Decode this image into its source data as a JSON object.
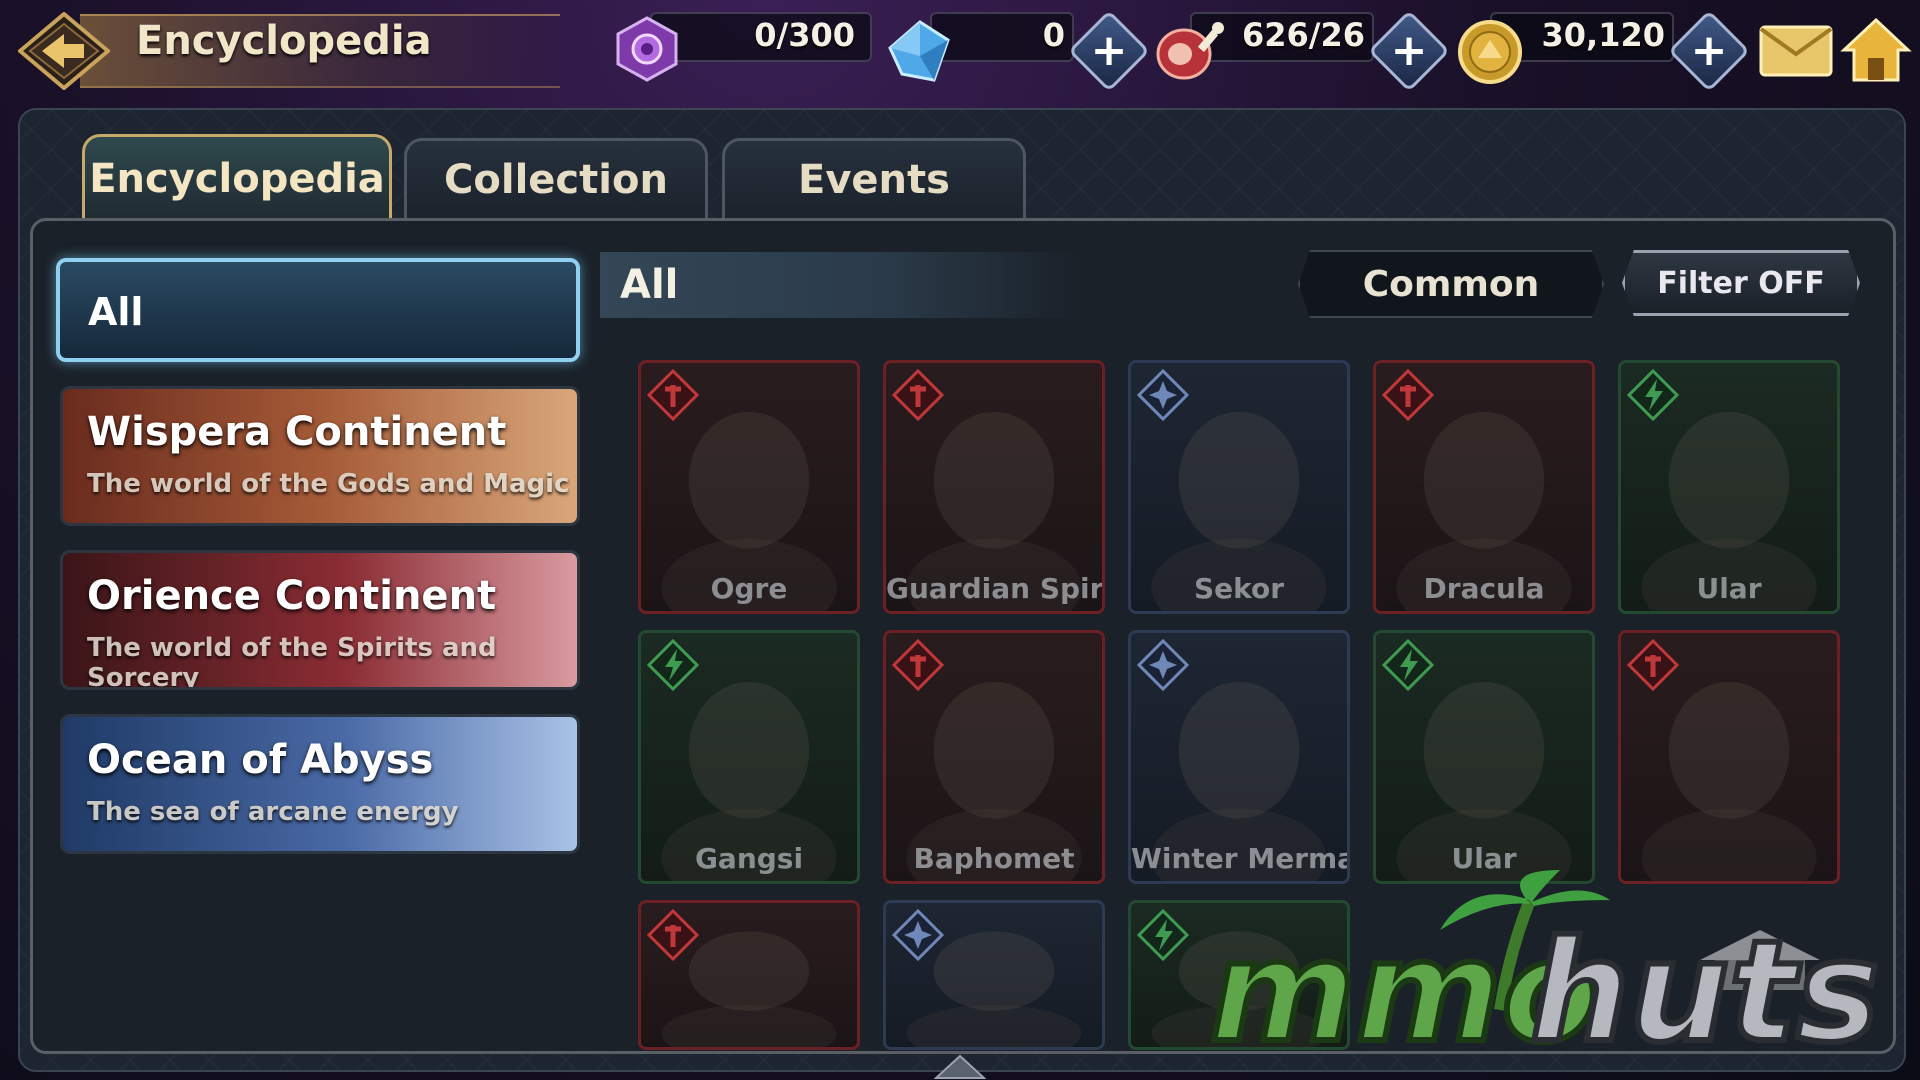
{
  "header": {
    "title": "Encyclopedia",
    "resources": [
      {
        "name": "soul-gem",
        "value": "0/300"
      },
      {
        "name": "crystal",
        "value": "0"
      },
      {
        "name": "meat-stamina",
        "value": "626/26"
      },
      {
        "name": "gold",
        "value": "30,120"
      }
    ]
  },
  "tabs": [
    {
      "label": "Encyclopedia",
      "active": true
    },
    {
      "label": "Collection",
      "active": false
    },
    {
      "label": "Events",
      "active": false
    }
  ],
  "categories": {
    "all_label": "All",
    "items": [
      {
        "title": "Wispera Continent",
        "subtitle": "The world of the Gods and Magic"
      },
      {
        "title": "Orience Continent",
        "subtitle": "The world of the Spirits and Sorcery"
      },
      {
        "title": "Ocean of Abyss",
        "subtitle": "The sea of arcane energy"
      }
    ]
  },
  "list_header": {
    "title": "All",
    "sort_label": "Common",
    "filter_label": "Filter OFF"
  },
  "cards": [
    {
      "name": "Ogre",
      "element": "fire"
    },
    {
      "name": "Guardian Spirit",
      "element": "fire"
    },
    {
      "name": "Sekor",
      "element": "water"
    },
    {
      "name": "Dracula",
      "element": "fire"
    },
    {
      "name": "Ular",
      "element": "wind"
    },
    {
      "name": "Gangsi",
      "element": "wind"
    },
    {
      "name": "Baphomet",
      "element": "fire"
    },
    {
      "name": "Winter Mermaid",
      "element": "water"
    },
    {
      "name": "Ular",
      "element": "wind"
    },
    {
      "name": "",
      "element": "fire"
    },
    {
      "name": "",
      "element": "fire"
    },
    {
      "name": "",
      "element": "water"
    },
    {
      "name": "",
      "element": "wind"
    }
  ],
  "watermark": "mmohuts",
  "colors": {
    "fire": "#c0383a",
    "water": "#6f88b8",
    "wind": "#3f9a52",
    "gold_accent": "#c7a969",
    "selected_glow": "#8fd0f0"
  },
  "icons": [
    "back-arrow-icon",
    "soul-gem-icon",
    "crystal-icon",
    "meat-icon",
    "gold-coin-icon",
    "plus-icon",
    "mail-icon",
    "home-icon",
    "fire-element-icon",
    "water-element-icon",
    "wind-element-icon"
  ]
}
